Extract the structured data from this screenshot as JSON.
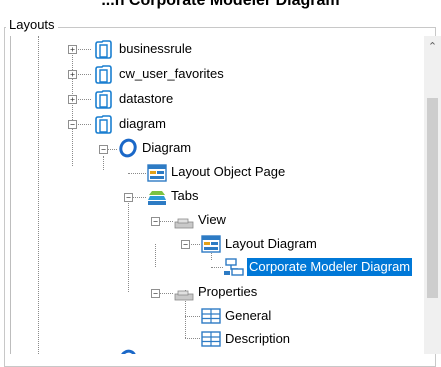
{
  "page_title": "...h Corporate Modeler Diagram",
  "group": {
    "label": "Layouts"
  },
  "tree": {
    "nodes": [
      {
        "label": "businessrule"
      },
      {
        "label": "cw_user_favorites"
      },
      {
        "label": "datastore"
      },
      {
        "label": "diagram"
      },
      {
        "label": "Diagram"
      },
      {
        "label": "Layout Object Page"
      },
      {
        "label": "Tabs"
      },
      {
        "label": "View"
      },
      {
        "label": "Layout Diagram"
      },
      {
        "label": "Corporate Modeler Diagram",
        "selected": true
      },
      {
        "label": "Properties"
      },
      {
        "label": "General"
      },
      {
        "label": "Description"
      }
    ]
  },
  "scrollbar": {
    "up_icon": "scroll-up-arrow-icon"
  },
  "colors": {
    "selection": "#0078d7",
    "folder": "#1a7fd0",
    "tree_lines": "#8a8a8a"
  }
}
